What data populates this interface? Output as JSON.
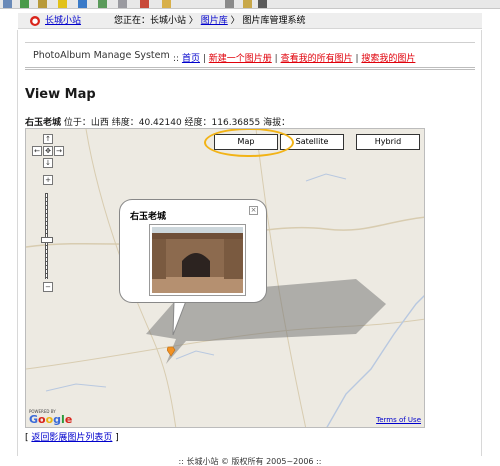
{
  "toolbar_icons": [
    "window-icon",
    "save-icon",
    "edit-icon",
    "star-icon",
    "back-icon",
    "refresh-icon",
    "page-icon",
    "stop-icon",
    "folder-icon",
    "cut-icon",
    "paste-icon",
    "image-icon"
  ],
  "breadcrumb": {
    "site_link": "长城小站",
    "location_prefix": "您正在：长城小站 〉",
    "album_link": "图片库",
    "location_suffix": "〉 图片库管理系统"
  },
  "nav": {
    "system_name": "PhotoAlbum Manage System",
    "sep1": "::",
    "home": "首页",
    "sep2": "|",
    "new_album": "新建一个图片册",
    "sep3": "|",
    "my_pictures": "查看我的所有图片",
    "sep4": "|",
    "search_pictures": "搜索我的图片"
  },
  "page_title": "View Map",
  "location_info": {
    "name": "右玉老城",
    "text": " 位于：山西 纬度：40.42140 经度：116.36855 海拔："
  },
  "map": {
    "type_buttons": [
      "Map",
      "Satellite",
      "Hybrid"
    ],
    "active_type": "Map",
    "pan_arrows": [
      "↑",
      "←",
      "✥",
      "→",
      "↓"
    ],
    "zoom_in": "+",
    "zoom_out": "−",
    "infowindow_title": "右玉老城",
    "close_symbol": "×",
    "powered_by": "POWERED BY",
    "logo": "Google",
    "terms": "Terms of Use",
    "colors": {
      "land": "#edeae2",
      "road": "#d8ccb0",
      "water": "#b8c8e0",
      "marker": "#f29224",
      "highlight": "#f2b316"
    }
  },
  "back_link": {
    "open": "[",
    "label": "返回影展图片列表页",
    "close": "]"
  },
  "footer": ":: 长城小站 © 版权所有  2005~2006 ::"
}
